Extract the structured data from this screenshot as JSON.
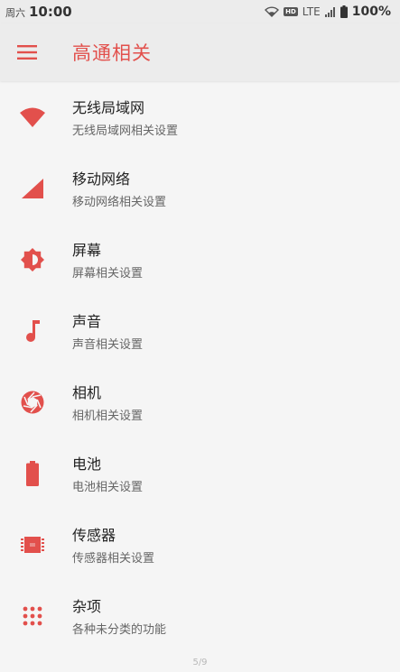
{
  "status_bar": {
    "day": "周六",
    "time": "10:00",
    "hd": "HD",
    "network": "LTE",
    "battery": "100%"
  },
  "app_bar": {
    "title": "高通相关"
  },
  "colors": {
    "accent": "#e2504c"
  },
  "items": [
    {
      "title": "无线局域网",
      "subtitle": "无线局域网相关设置",
      "icon": "wifi-icon"
    },
    {
      "title": "移动网络",
      "subtitle": "移动网络相关设置",
      "icon": "cellular-signal-icon"
    },
    {
      "title": "屏幕",
      "subtitle": "屏幕相关设置",
      "icon": "brightness-icon"
    },
    {
      "title": "声音",
      "subtitle": "声音相关设置",
      "icon": "music-note-icon"
    },
    {
      "title": "相机",
      "subtitle": "相机相关设置",
      "icon": "camera-aperture-icon"
    },
    {
      "title": "电池",
      "subtitle": "电池相关设置",
      "icon": "battery-icon"
    },
    {
      "title": "传感器",
      "subtitle": "传感器相关设置",
      "icon": "chip-icon"
    },
    {
      "title": "杂项",
      "subtitle": "各种未分类的功能",
      "icon": "apps-grid-icon"
    }
  ],
  "page_indicator": "5/9"
}
